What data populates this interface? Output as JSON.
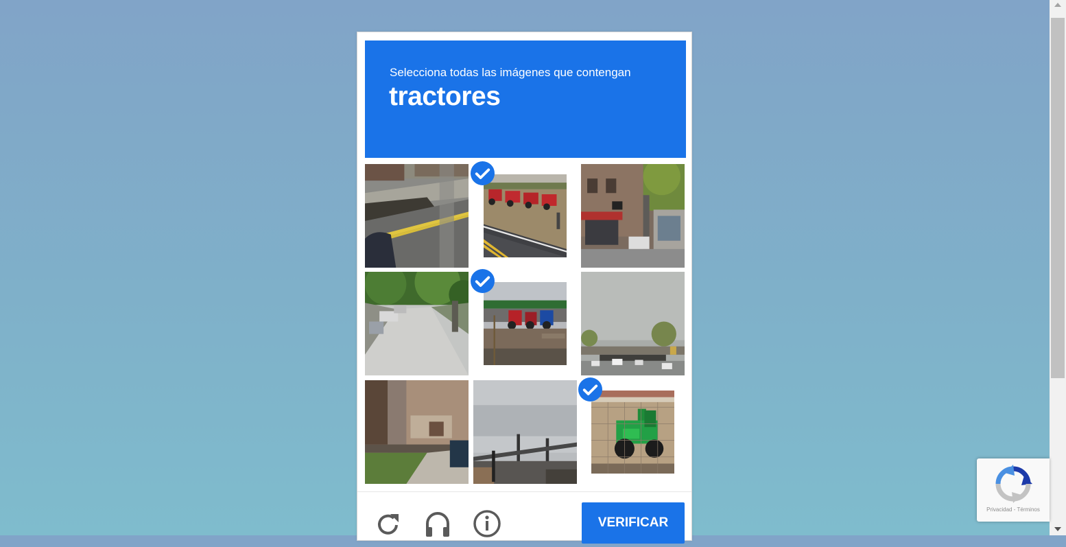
{
  "captcha": {
    "instruction": "Selecciona todas las imágenes que contengan",
    "target": "tractores",
    "tiles": [
      {
        "selected": false,
        "scene": "residential street"
      },
      {
        "selected": true,
        "scene": "red tractors on roadside"
      },
      {
        "selected": false,
        "scene": "storefront"
      },
      {
        "selected": false,
        "scene": "tree-lined street"
      },
      {
        "selected": true,
        "scene": "red and blue tractors"
      },
      {
        "selected": false,
        "scene": "highway underpass"
      },
      {
        "selected": false,
        "scene": "building porch"
      },
      {
        "selected": false,
        "scene": "bridge under cloudy sky"
      },
      {
        "selected": true,
        "scene": "green tractor"
      }
    ],
    "verify_label": "VERIFICAR",
    "icons": {
      "reload": "reload-icon",
      "audio": "headphones-icon",
      "info": "info-icon"
    }
  },
  "badge": {
    "privacy": "Privacidad",
    "separator": "-",
    "terms": "Términos"
  },
  "colors": {
    "accent": "#1a73e8",
    "page_top": "#81a4c8",
    "page_bottom": "#7fbccd"
  }
}
